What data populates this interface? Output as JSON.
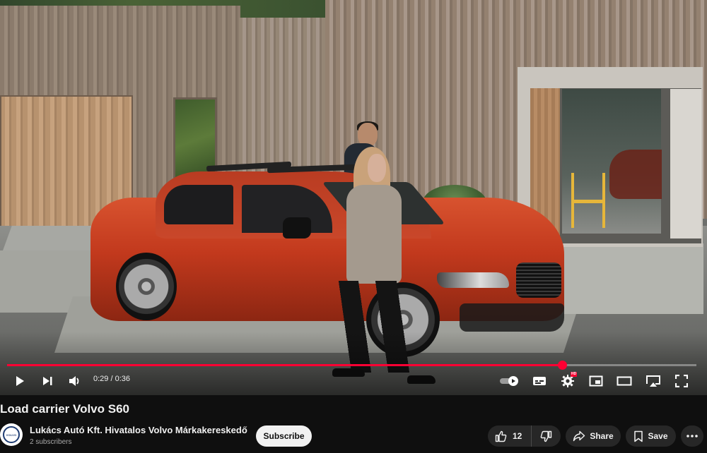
{
  "player": {
    "current_time": "0:29",
    "duration": "0:36",
    "time_separator": " / ",
    "progress_fraction": 0.805,
    "hd_badge": "HD",
    "accent_color": "#ff0033"
  },
  "icons": {
    "play": "play-icon",
    "next": "next-icon",
    "volume": "volume-icon",
    "autoplay": "autoplay-toggle-icon",
    "subtitles": "subtitles-icon",
    "settings": "gear-icon",
    "miniplayer": "miniplayer-icon",
    "theater": "theater-mode-icon",
    "cast": "cast-icon",
    "fullscreen": "fullscreen-icon"
  },
  "video": {
    "title": "Load carrier Volvo S60"
  },
  "channel": {
    "name": "Lukács Autó Kft. Hivatalos Volvo Márkakereskedő",
    "subscribers": "2 subscribers",
    "avatar_text": "VOLVO",
    "subscribe_label": "Subscribe"
  },
  "actions": {
    "like_count": "12",
    "share_label": "Share",
    "save_label": "Save"
  }
}
